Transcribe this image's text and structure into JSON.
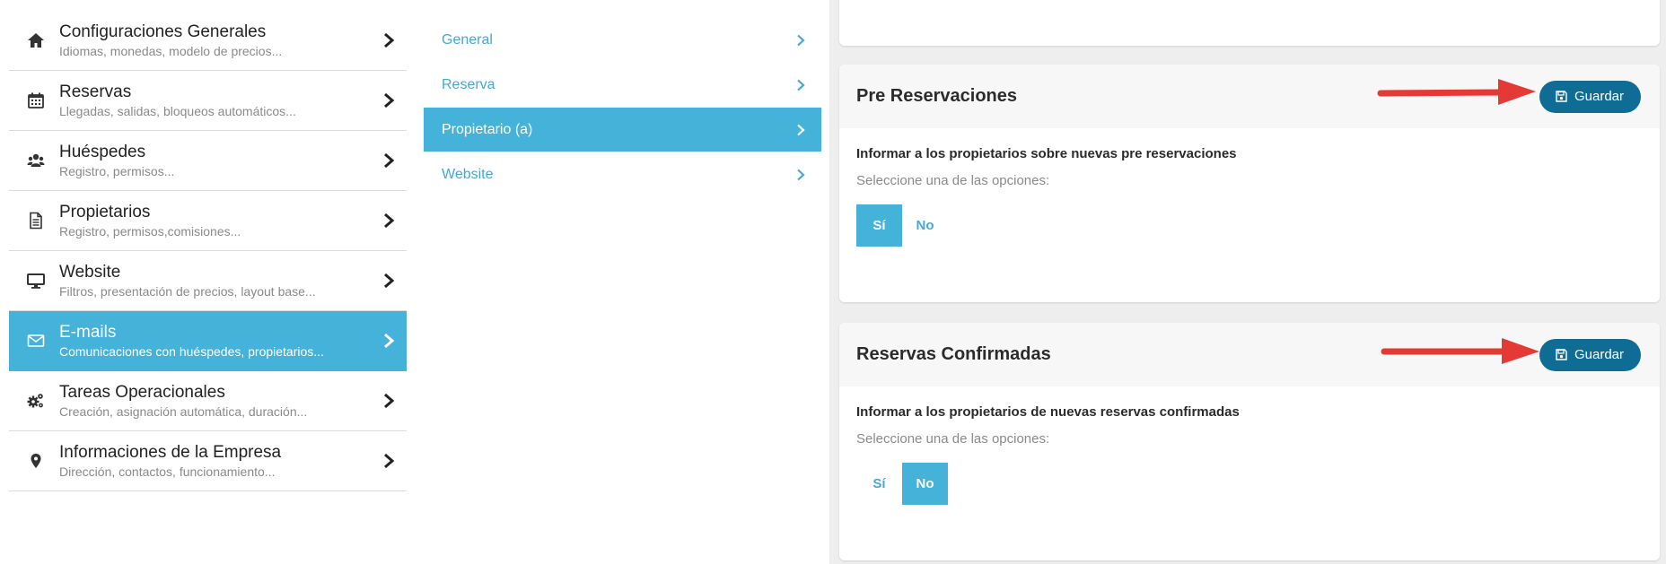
{
  "menu": {
    "items": [
      {
        "title": "Configuraciones Generales",
        "subtitle": "Idiomas, monedas, modelo de precios...",
        "icon": "home-icon"
      },
      {
        "title": "Reservas",
        "subtitle": "Llegadas, salidas, bloqueos automáticos...",
        "icon": "calendar-icon"
      },
      {
        "title": "Huéspedes",
        "subtitle": "Registro, permisos...",
        "icon": "users-icon"
      },
      {
        "title": "Propietarios",
        "subtitle": "Registro, permisos,comisiones...",
        "icon": "document-icon"
      },
      {
        "title": "Website",
        "subtitle": "Filtros, presentación de precios, layout base...",
        "icon": "monitor-icon"
      },
      {
        "title": "E-mails",
        "subtitle": "Comunicaciones con huéspedes, propietarios...",
        "icon": "envelope-icon",
        "active": true
      },
      {
        "title": "Tareas Operacionales",
        "subtitle": "Creación, asignación automática, duración...",
        "icon": "gears-icon"
      },
      {
        "title": "Informaciones de la Empresa",
        "subtitle": "Dirección, contactos, funcionamiento...",
        "icon": "map-pin-icon"
      }
    ]
  },
  "submenu": {
    "items": [
      {
        "label": "General"
      },
      {
        "label": "Reserva"
      },
      {
        "label": "Propietario (a)",
        "active": true
      },
      {
        "label": "Website"
      }
    ]
  },
  "sections": [
    {
      "title": "Pre Reservaciones",
      "save_label": "Guardar",
      "question": "Informar a los propietarios sobre nuevas pre reservaciones",
      "hint": "Seleccione una de las opciones:",
      "options": [
        "Sí",
        "No"
      ],
      "selected": "Sí"
    },
    {
      "title": "Reservas Confirmadas",
      "save_label": "Guardar",
      "question": "Informar a los propietarios de nuevas reservas confirmadas",
      "hint": "Seleccione una de las opciones:",
      "options": [
        "Sí",
        "No"
      ],
      "selected": "No"
    }
  ],
  "colors": {
    "accent": "#45b2d9",
    "save_button": "#0f6d95",
    "annotation_arrow": "#e53935"
  }
}
